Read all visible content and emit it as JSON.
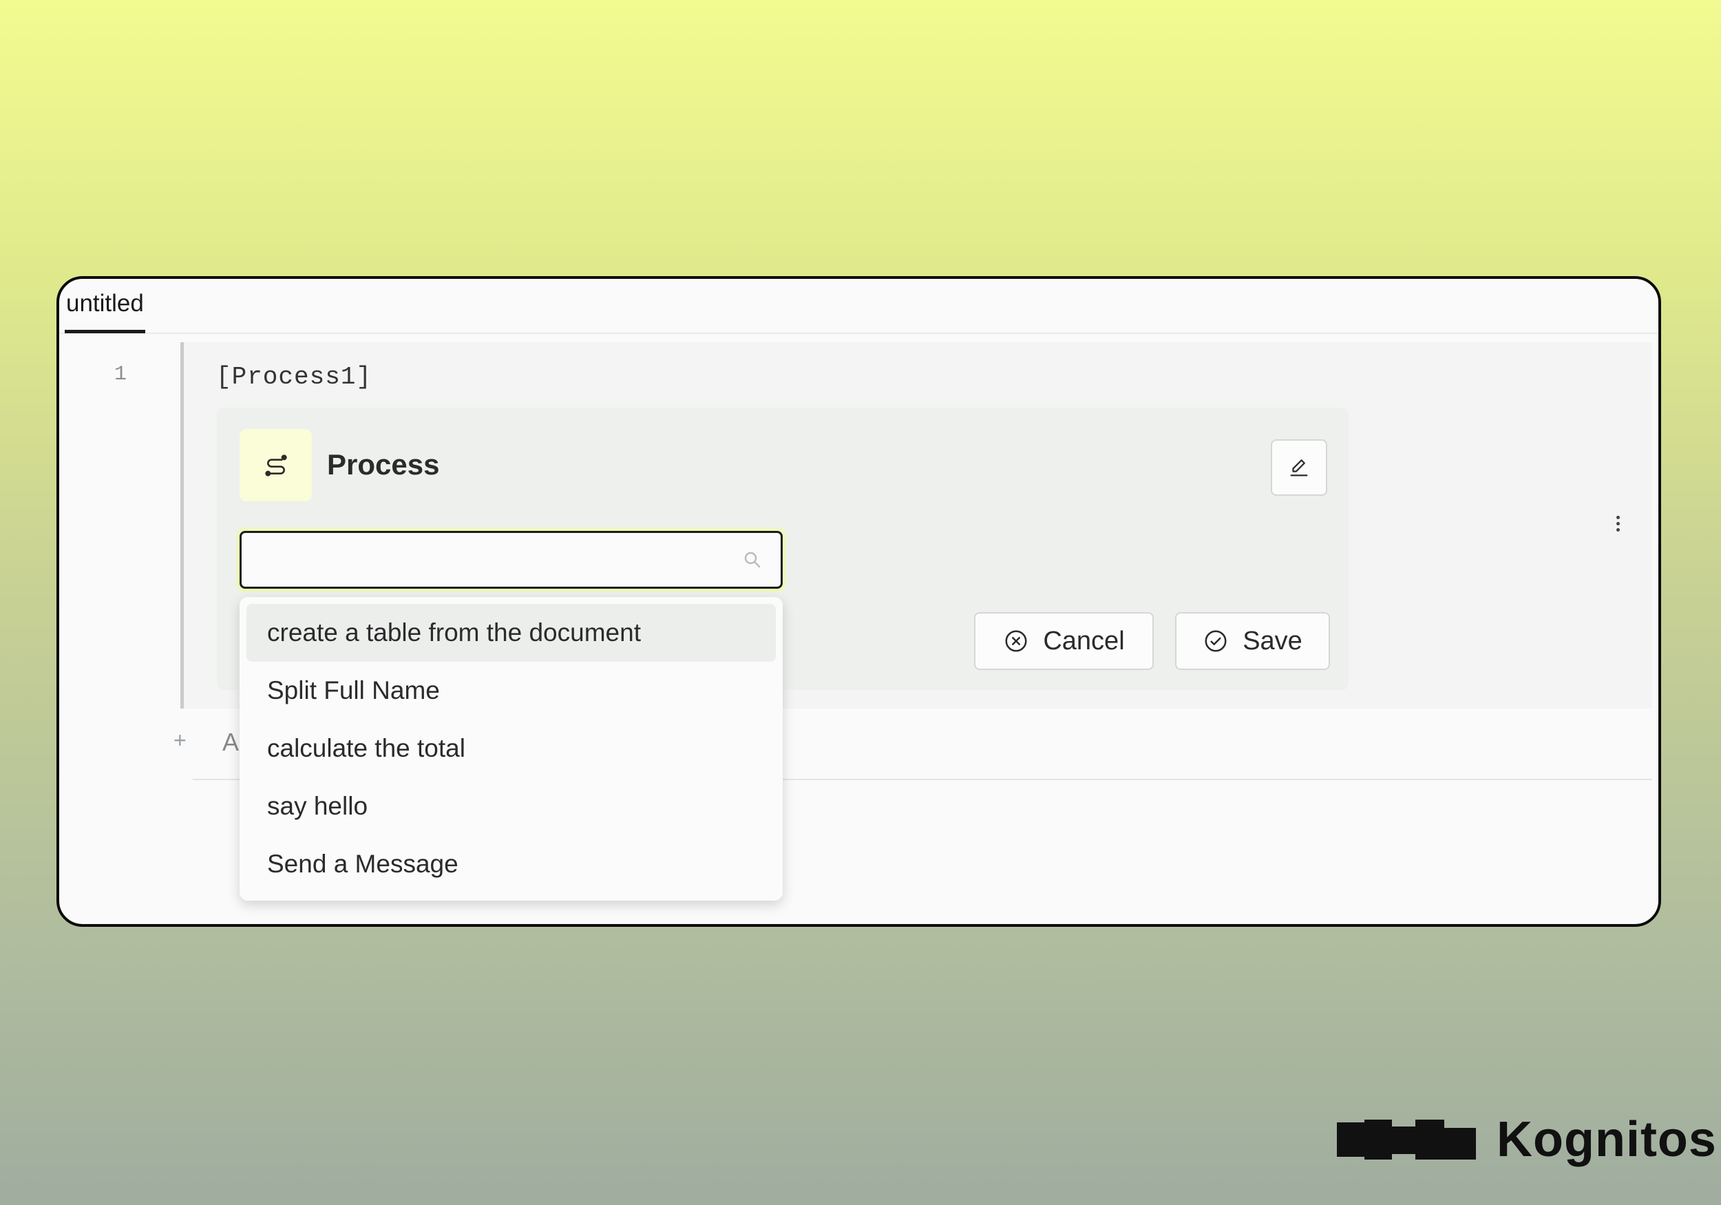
{
  "tab": {
    "label": "untitled"
  },
  "editor": {
    "line_number": "1",
    "process_reference": "[Process1]",
    "add_label": "A"
  },
  "process_card": {
    "title": "Process",
    "icon": "route-icon",
    "edit_icon": "pencil-icon"
  },
  "search": {
    "value": "",
    "placeholder": ""
  },
  "dropdown": {
    "items": [
      {
        "label": "create a table from the document",
        "active": true
      },
      {
        "label": "Split Full Name"
      },
      {
        "label": "calculate the total"
      },
      {
        "label": "say hello"
      },
      {
        "label": "Send a Message"
      }
    ]
  },
  "actions": {
    "cancel_label": "Cancel",
    "save_label": "Save"
  },
  "brand": {
    "name": "Kognitos"
  },
  "colors": {
    "accent_yellow": "#fbfcd8",
    "focus_ring": "#eef8bd"
  }
}
